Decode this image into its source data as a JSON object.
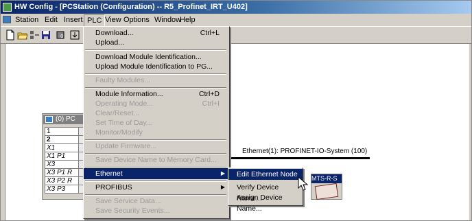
{
  "window": {
    "title": "HW Config - [PCStation (Configuration) -- R5_Profinet_IRT_U402]"
  },
  "menubar": {
    "items": [
      "Station",
      "Edit",
      "Insert",
      "PLC",
      "View",
      "Options",
      "Window",
      "Help"
    ]
  },
  "toolbar": {
    "icons": [
      "new-icon",
      "open-icon",
      "station-icon",
      "save-icon",
      "compile-icon"
    ]
  },
  "plc_menu": {
    "download": "Download...",
    "download_shortcut": "Ctrl+L",
    "upload": "Upload...",
    "download_module_id": "Download Module Identification...",
    "upload_module_id": "Upload Module Identification to PG...",
    "faulty_modules": "Faulty Modules...",
    "module_information": "Module Information...",
    "module_information_shortcut": "Ctrl+D",
    "operating_mode": "Operating Mode...",
    "operating_mode_shortcut": "Ctrl+I",
    "clear_reset": "Clear/Reset...",
    "set_time": "Set Time of Day...",
    "monitor_modify": "Monitor/Modify",
    "update_firmware": "Update Firmware...",
    "save_device_name": "Save Device Name to Memory Card...",
    "ethernet": "Ethernet",
    "profibus": "PROFIBUS",
    "save_service_data": "Save Service Data...",
    "save_security_events": "Save Security Events..."
  },
  "ethernet_submenu": {
    "edit_node": "Edit Ethernet Node",
    "verify_name": "Verify Device Name...",
    "assign_name": "Assign Device Name..."
  },
  "rack": {
    "title": "(0) PC",
    "rows": [
      "1",
      "2",
      "X1",
      "X1 P1",
      "X3",
      "X3 P1 R",
      "X3 P2 R",
      "X3 P3"
    ]
  },
  "network": {
    "label": "Ethernet(1): PROFINET-IO-System (100)"
  },
  "device": {
    "title": "MTS-R-S"
  },
  "colors": {
    "highlight": "#0a246a",
    "menu_bg": "#d4d0c8",
    "disabled_text": "#9b9b9b"
  }
}
